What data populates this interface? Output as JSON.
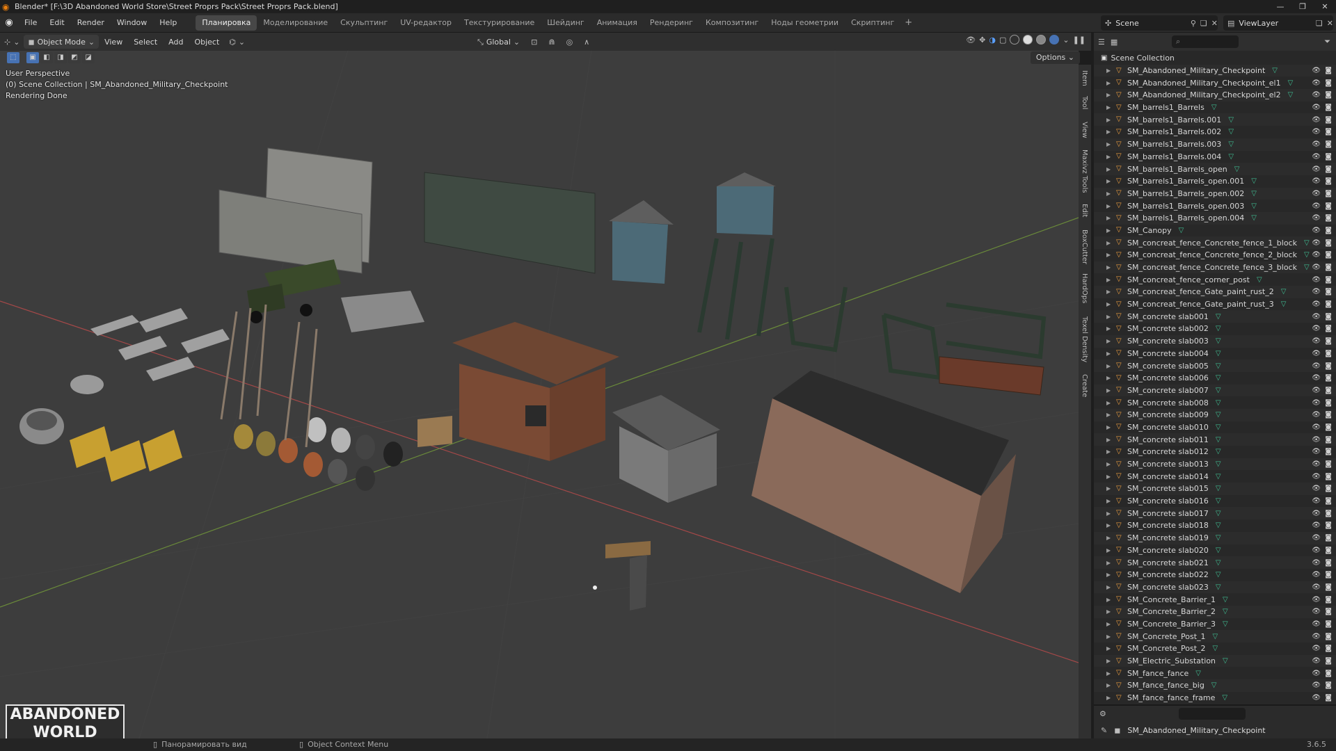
{
  "window": {
    "title": "Blender* [F:\\3D Abandoned World Store\\Street Proprs Pack\\Street Proprs Pack.blend]",
    "controls": [
      "—",
      "❐",
      "✕"
    ]
  },
  "menu": [
    "File",
    "Edit",
    "Render",
    "Window",
    "Help"
  ],
  "workspaces": [
    {
      "label": "Планировка",
      "active": true
    },
    {
      "label": "Моделирование",
      "active": false
    },
    {
      "label": "Скульптинг",
      "active": false
    },
    {
      "label": "UV-редактор",
      "active": false
    },
    {
      "label": "Текстурирование",
      "active": false
    },
    {
      "label": "Шейдинг",
      "active": false
    },
    {
      "label": "Анимация",
      "active": false
    },
    {
      "label": "Рендеринг",
      "active": false
    },
    {
      "label": "Композитинг",
      "active": false
    },
    {
      "label": "Ноды геометрии",
      "active": false
    },
    {
      "label": "Скриптинг",
      "active": false
    }
  ],
  "scene": {
    "label": "Scene"
  },
  "view_layer": {
    "label": "ViewLayer"
  },
  "viewport_header": {
    "mode": "Object Mode",
    "menu": [
      "View",
      "Select",
      "Add",
      "Object"
    ],
    "transform_orientation": "Global",
    "options": "Options"
  },
  "viewport_overlay": {
    "perspective": "User Perspective",
    "collection": "(0) Scene Collection | SM_Abandoned_Military_Checkpoint",
    "status": "Rendering Done"
  },
  "side_tabs": [
    "Item",
    "Tool",
    "View",
    "Maxivz Tools",
    "Edit",
    "BoxCutter",
    "HardOps",
    "Texel Density",
    "Create"
  ],
  "watermark": {
    "line1": "ABANDONED",
    "line2": "WORLD"
  },
  "outliner": {
    "root": "Scene Collection",
    "items": [
      "SM_Abandoned_Military_Checkpoint",
      "SM_Abandoned_Military_Checkpoint_el1",
      "SM_Abandoned_Military_Checkpoint_el2",
      "SM_barrels1_Barrels",
      "SM_barrels1_Barrels.001",
      "SM_barrels1_Barrels.002",
      "SM_barrels1_Barrels.003",
      "SM_barrels1_Barrels.004",
      "SM_barrels1_Barrels_open",
      "SM_barrels1_Barrels_open.001",
      "SM_barrels1_Barrels_open.002",
      "SM_barrels1_Barrels_open.003",
      "SM_barrels1_Barrels_open.004",
      "SM_Canopy",
      "SM_concreat_fence_Concrete_fence_1_block",
      "SM_concreat_fence_Concrete_fence_2_block",
      "SM_concreat_fence_Concrete_fence_3_block",
      "SM_concreat_fence_corner_post",
      "SM_concreat_fence_Gate_paint_rust_2",
      "SM_concreat_fence_Gate_paint_rust_3",
      "SM_concrete slab001",
      "SM_concrete slab002",
      "SM_concrete slab003",
      "SM_concrete slab004",
      "SM_concrete slab005",
      "SM_concrete slab006",
      "SM_concrete slab007",
      "SM_concrete slab008",
      "SM_concrete slab009",
      "SM_concrete slab010",
      "SM_concrete slab011",
      "SM_concrete slab012",
      "SM_concrete slab013",
      "SM_concrete slab014",
      "SM_concrete slab015",
      "SM_concrete slab016",
      "SM_concrete slab017",
      "SM_concrete slab018",
      "SM_concrete slab019",
      "SM_concrete slab020",
      "SM_concrete slab021",
      "SM_concrete slab022",
      "SM_concrete slab023",
      "SM_Concrete_Barrier_1",
      "SM_Concrete_Barrier_2",
      "SM_Concrete_Barrier_3",
      "SM_Concrete_Post_1",
      "SM_Concrete_Post_2",
      "SM_Electric_Substation",
      "SM_fance_fance",
      "SM_fance_fance_big",
      "SM_fance_fance_frame"
    ]
  },
  "properties": {
    "active_object": "SM_Abandoned_Military_Checkpoint"
  },
  "statusbar": {
    "pan": "Панорамировать вид",
    "context": "Object Context Menu",
    "version": "3.6.5"
  },
  "colors": {
    "accent": "#4772b3",
    "object_orange": "#f0a040",
    "mesh_green": "#3fbf93"
  }
}
